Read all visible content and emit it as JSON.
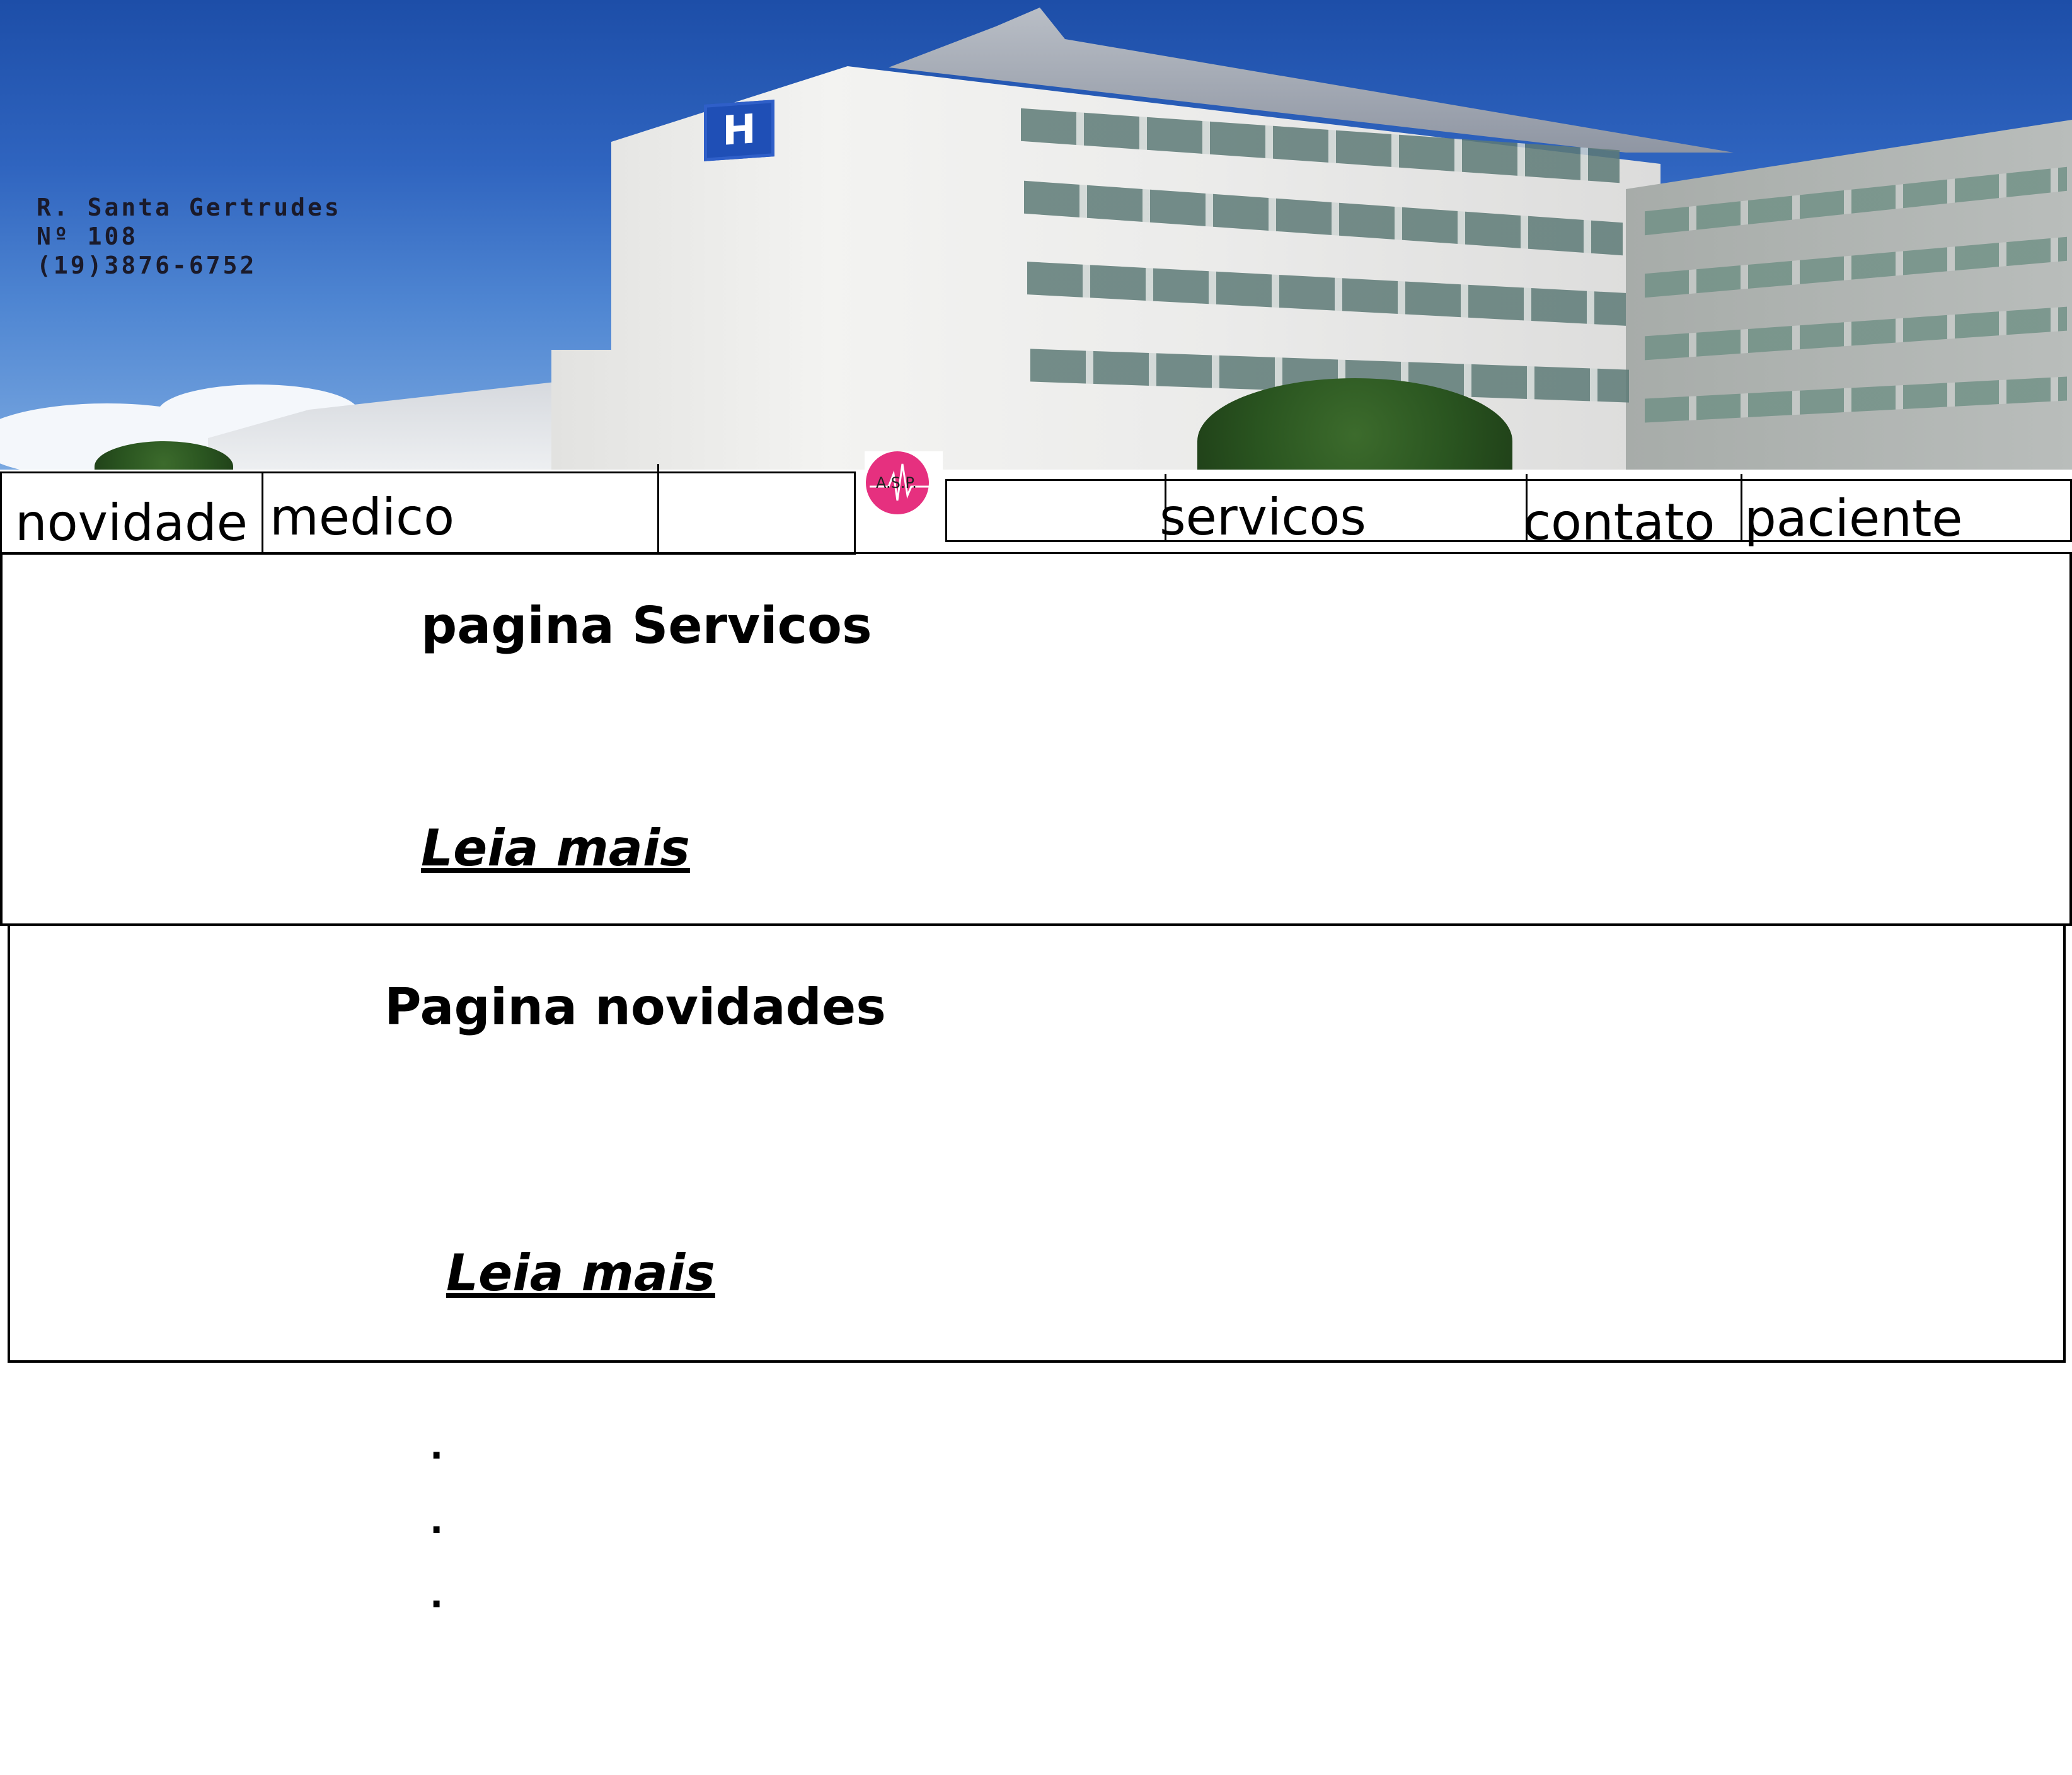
{
  "header": {
    "address_line1": "R. Santa Gertrudes",
    "address_line2": "Nº 108",
    "phone": "(19)3876-6752",
    "hospital_sign": "H"
  },
  "logo": {
    "text": "A.S.P."
  },
  "nav": {
    "items": [
      {
        "label": "novidade"
      },
      {
        "label": "medico"
      },
      {
        "label": "servicos"
      },
      {
        "label": "contato"
      },
      {
        "label": "paciente"
      }
    ]
  },
  "sections": [
    {
      "title": "pagina Servicos",
      "link": "Leia mais"
    },
    {
      "title": "Pagina novidades",
      "link": "Leia mais"
    }
  ],
  "ellipsis": [
    ".",
    ".",
    "."
  ],
  "colors": {
    "logo_accent": "#e6307f",
    "sky": "#1d4ea8",
    "border": "#000000"
  }
}
